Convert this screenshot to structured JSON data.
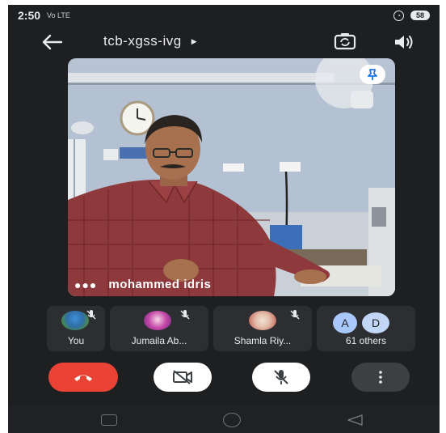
{
  "status_bar": {
    "time": "2:50",
    "signal": "Vo LTE",
    "battery": "58"
  },
  "meeting": {
    "title": "tcb-xgss-ivg"
  },
  "main_video": {
    "speaker_name": "mohammed idris"
  },
  "participants": [
    {
      "label": "You",
      "muted": true
    },
    {
      "label": "Jumaila Ab...",
      "muted": true
    },
    {
      "label": "Shamla Riy...",
      "muted": true
    },
    {
      "label": "61 others",
      "avatars": [
        "A",
        "D"
      ]
    }
  ],
  "colors": {
    "background": "#1e1f21",
    "tile": "#2d2e31",
    "end_call": "#ea4335",
    "pin_icon": "#1a73e8",
    "avatar_a": "#a8c7fa",
    "avatar_d": "#c2d6f7"
  },
  "icons": {
    "back": "arrow-left-icon",
    "dropdown": "caret-right-icon",
    "flip_camera": "flip-camera-icon",
    "speaker": "volume-icon",
    "pin": "pin-icon",
    "more_options": "three-dots-icon",
    "end_call": "phone-hangup-icon",
    "camera_off": "camera-off-icon",
    "mic_off": "mic-off-icon",
    "overflow": "vertical-dots-icon"
  }
}
